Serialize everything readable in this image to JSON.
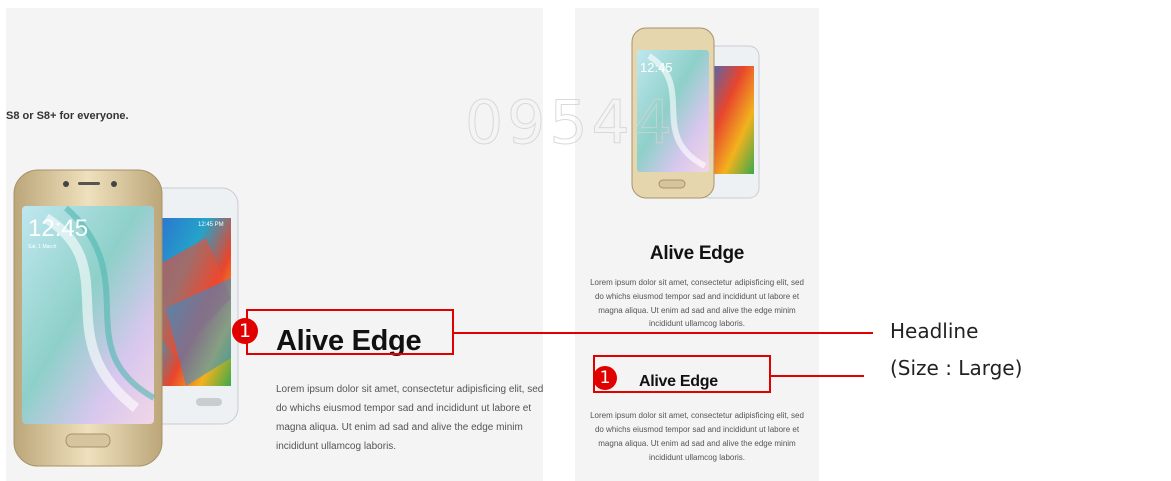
{
  "left": {
    "subtitle": "S8 or S8+ for everyone.",
    "headline": "Alive Edge",
    "body": "Lorem ipsum dolor sit amet, consectetur adipisficing elit, sed do whichs eiusmod tempor sad and incididunt ut labore et magna aliqua. Ut enim ad sad and alive the edge minim incididunt ullamcog laboris.",
    "phone_front_time": "12:45",
    "phone_front_date": "Sat, 1 March",
    "phone_back_time": "12:45 PM"
  },
  "right": {
    "headline_1": "Alive Edge",
    "body_1": "Lorem ipsum dolor sit amet, consectetur adipisficing elit, sed do whichs eiusmod tempor sad and incididunt ut labore et magna aliqua. Ut enim ad sad and alive the edge minim incididunt ullamcog laboris.",
    "headline_2": "Alive Edge",
    "body_2": "Lorem ipsum dolor sit amet, consectetur adipisficing elit, sed do whichs eiusmod tempor sad and incididunt ut labore et magna aliqua. Ut enim ad sad and alive the edge minim incididunt ullamcog laboris.",
    "phone_time": "12:45"
  },
  "annotation": {
    "badge_label": "1",
    "line1": "Headline",
    "line2": "(Size : Large)"
  },
  "watermark": "09544",
  "colors": {
    "annotation_red": "#e00000",
    "panel_bg": "#f4f4f4"
  }
}
